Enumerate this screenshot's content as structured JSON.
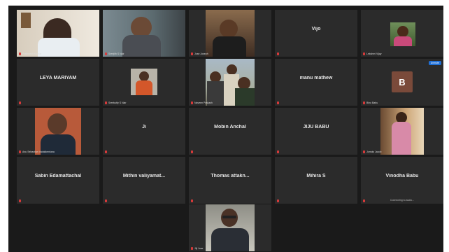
{
  "meeting": {
    "participants": [
      {
        "id": "p01",
        "type": "video",
        "name": "Pratheesh Kumar",
        "active": true
      },
      {
        "id": "p02",
        "type": "video",
        "name": "Sreejith S Nair"
      },
      {
        "id": "p03",
        "type": "video",
        "name": "Jose Joseph"
      },
      {
        "id": "p04",
        "type": "name",
        "name": "Vijo"
      },
      {
        "id": "p05",
        "type": "video",
        "name": "Lekshmi Vijay"
      },
      {
        "id": "p06",
        "type": "name",
        "name": "LEYA MARIYAM"
      },
      {
        "id": "p07",
        "type": "video",
        "name": "Sreekutty S Nair"
      },
      {
        "id": "p08",
        "type": "video",
        "name": "Naveen Prakash"
      },
      {
        "id": "p09",
        "type": "name",
        "name": "manu mathew"
      },
      {
        "id": "p10",
        "type": "avatar",
        "name": "Bino Babu",
        "initial": "B",
        "badge": "Unmute"
      },
      {
        "id": "p11",
        "type": "video",
        "name": "Anu Sebastian Vadakkenkara"
      },
      {
        "id": "p12",
        "type": "name",
        "name": "Ji"
      },
      {
        "id": "p13",
        "type": "name",
        "name": "Mobin Anchal"
      },
      {
        "id": "p14",
        "type": "name",
        "name": "JIJU BABU"
      },
      {
        "id": "p15",
        "type": "video",
        "name": "Jomols Jacob"
      },
      {
        "id": "p16",
        "type": "name",
        "name": "Sabin Edamattachal"
      },
      {
        "id": "p17",
        "type": "name",
        "name": "Mithin valiyamat..."
      },
      {
        "id": "p18",
        "type": "name",
        "name": "Thomas attakn..."
      },
      {
        "id": "p19",
        "type": "name",
        "name": "Mihira S"
      },
      {
        "id": "p20",
        "type": "name",
        "name": "Vinodha Babu",
        "status": "Connecting to audio..."
      },
      {
        "id": "p21",
        "type": "video",
        "name": "Jiji Jose"
      }
    ]
  },
  "colors": {
    "active_border": "#c9d94a",
    "tile": "#2b2b2b",
    "stage": "#1a1a1a",
    "mic_muted": "#d83a3a"
  }
}
